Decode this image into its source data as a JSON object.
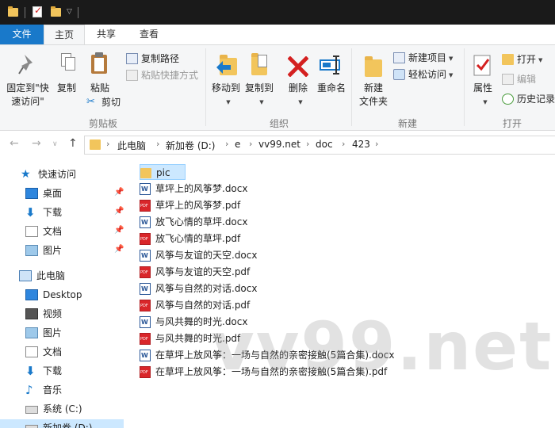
{
  "ribbon_tabs": {
    "file": "文件",
    "home": "主页",
    "share": "共享",
    "view": "查看"
  },
  "clipboard": {
    "pin_quick_access_l1": "固定到\"快",
    "pin_quick_access_l2": "速访问\"",
    "copy": "复制",
    "paste": "粘贴",
    "copy_path": "复制路径",
    "paste_shortcut": "粘贴快捷方式",
    "cut": "剪切",
    "group_label": "剪贴板"
  },
  "organize": {
    "move_to": "移动到",
    "copy_to": "复制到",
    "delete": "删除",
    "rename": "重命名",
    "group_label": "组织"
  },
  "new_group": {
    "new_folder_l1": "新建",
    "new_folder_l2": "文件夹",
    "new_item": "新建项目",
    "easy_access": "轻松访问",
    "group_label": "新建"
  },
  "open_group": {
    "properties": "属性",
    "open": "打开",
    "edit": "编辑",
    "history": "历史记录",
    "group_label": "打开"
  },
  "address": {
    "crumbs": [
      "此电脑",
      "新加卷 (D:)",
      "e",
      "vv99.net",
      "doc",
      "423"
    ]
  },
  "nav": {
    "quick_access": "快速访问",
    "qa_items": [
      "桌面",
      "下载",
      "文档",
      "图片"
    ],
    "this_pc": "此电脑",
    "pc_items": [
      "Desktop",
      "视频",
      "图片",
      "文档",
      "下载",
      "音乐",
      "系统 (C:)",
      "新加卷 (D:)"
    ]
  },
  "files": [
    {
      "name": "pic",
      "type": "folder"
    },
    {
      "name": "草坪上的风筝梦.docx",
      "type": "docx"
    },
    {
      "name": "草坪上的风筝梦.pdf",
      "type": "pdf"
    },
    {
      "name": "放飞心情的草坪.docx",
      "type": "docx"
    },
    {
      "name": "放飞心情的草坪.pdf",
      "type": "pdf"
    },
    {
      "name": "风筝与友谊的天空.docx",
      "type": "docx"
    },
    {
      "name": "风筝与友谊的天空.pdf",
      "type": "pdf"
    },
    {
      "name": "风筝与自然的对话.docx",
      "type": "docx"
    },
    {
      "name": "风筝与自然的对话.pdf",
      "type": "pdf"
    },
    {
      "name": "与风共舞的时光.docx",
      "type": "docx"
    },
    {
      "name": "与风共舞的时光.pdf",
      "type": "pdf"
    },
    {
      "name": "在草坪上放风筝：一场与自然的亲密接触(5篇合集).docx",
      "type": "docx"
    },
    {
      "name": "在草坪上放风筝：一场与自然的亲密接触(5篇合集).pdf",
      "type": "pdf"
    }
  ],
  "watermark": "vv99.net",
  "colors": {
    "accent": "#1979ca",
    "selection": "#cce8ff",
    "folder": "#f2c55c",
    "pdf": "#d9262a",
    "word": "#2b5797"
  }
}
